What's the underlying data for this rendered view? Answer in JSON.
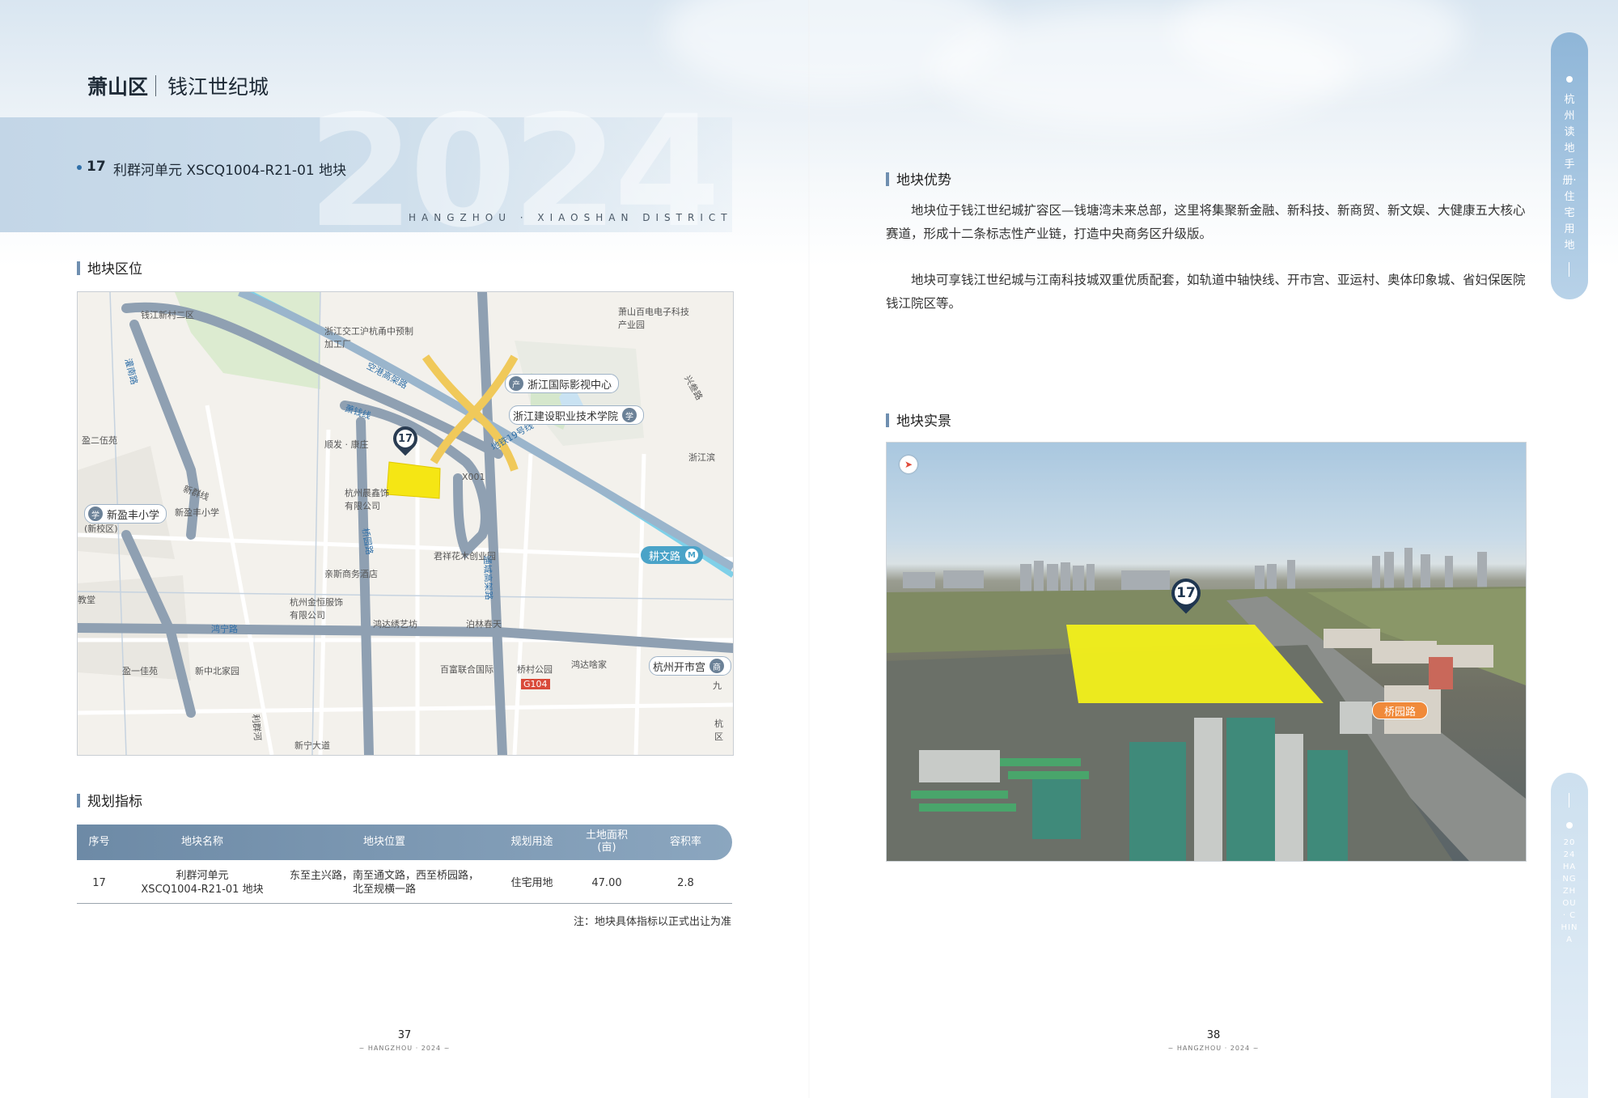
{
  "header": {
    "district": "萧山区",
    "area": "钱江世纪城",
    "year_watermark": "2024",
    "plot_no": "17",
    "plot_name": "利群河单元 XSCQ1004-R21-01 地块",
    "district_en": "HANGZHOU · XIAOSHAN DISTRICT"
  },
  "sections": {
    "location": "地块区位",
    "indicators": "规划指标",
    "advantage": "地块优势",
    "photo": "地块实景"
  },
  "map": {
    "marker": "17",
    "labels": {
      "qianjiang_xincun": "钱江新村二区",
      "xiaoshan_baidian": "萧山百电电子科技产业园",
      "zhejiang_jiaogong": "浙江交工沪杭甬中预制加工厂",
      "konggang": "空港高架路",
      "dingnan": "灌南路",
      "xiaoqian": "萧钱线",
      "shunfa": "顺发 · 康庄",
      "ying_erwu": "盈二伍苑",
      "xinqun": "新群线",
      "hangzhou_jing": "杭州晨鑫饰有限公司",
      "qiaoyuan": "桥园路",
      "metro19": "地铁19号线",
      "x001": "X001",
      "junxiang": "君祥花木创业园",
      "tongcheng": "通城高架路",
      "qiwen": "耕文路",
      "liusi": "亲斯商务酒店",
      "jinheng": "杭州金恒服饰有限公司",
      "hongda_xiuyi": "鸿达绣艺坊",
      "hongning": "鸿宁路",
      "bolin": "泊林春天",
      "ying_yijia": "盈一佳苑",
      "xinzhong_beijia": "新中北家园",
      "baifu": "百富联合国际",
      "qiaocun": "桥村公园",
      "hongdan_jin": "鸿达啥家",
      "g104": "G104",
      "liqun_he": "利群河",
      "xinning": "新宁大道",
      "jiaotang": "教堂",
      "xinzhi": "(新校区)",
      "xinying_feng": "新盈丰小学",
      "xinying_feng2": "新盈丰小学",
      "qianjiang_yl": "浙江滨",
      "xingsu": "兴叁路",
      "jiu": "九",
      "hangzhou_e": "杭区"
    },
    "pois": {
      "film": "浙江国际影视中心",
      "college": "浙江建设职业技术学院",
      "school": "新盈丰小学",
      "metro_qiwen": "耕文路",
      "kaishigong": "杭州开市宫"
    }
  },
  "table": {
    "headers": [
      "序号",
      "地块名称",
      "地块位置",
      "规划用途",
      "土地面积\n(亩)",
      "容积率"
    ],
    "rows": [
      [
        "17",
        "利群河单元\nXSCQ1004-R21-01 地块",
        "东至主兴路，南至通文路，西至桥园路，\n北至规横一路",
        "住宅用地",
        "47.00",
        "2.8"
      ]
    ],
    "note": "注：地块具体指标以正式出让为准"
  },
  "advantage": {
    "p1": "地块位于钱江世纪城扩容区—钱塘湾未来总部，这里将集聚新金融、新科技、新商贸、新文娱、大健康五大核心赛道，形成十二条标志性产业链，打造中央商务区升级版。",
    "p2": "地块可享钱江世纪城与江南科技城双重优质配套，如轨道中轴快线、开市宫、亚运村、奥体印象城、省妇保医院钱江院区等。"
  },
  "photo": {
    "marker": "17",
    "road_tag": "桥园路"
  },
  "footer": {
    "left_page": "37",
    "left_sub": "~ HANGZHOU · 2024 ~",
    "right_page": "38",
    "right_sub": "~ HANGZHOU · 2024 ~"
  },
  "side": {
    "tab1": "杭州读地手册·住宅用地",
    "tab2": "2024 HANGZHOU · CHINA"
  },
  "colors": {
    "accent": "#6f8fb0",
    "plot_yellow": "#f5e614",
    "road_tag": "#f08a3a",
    "marker": "#2a3c52"
  }
}
